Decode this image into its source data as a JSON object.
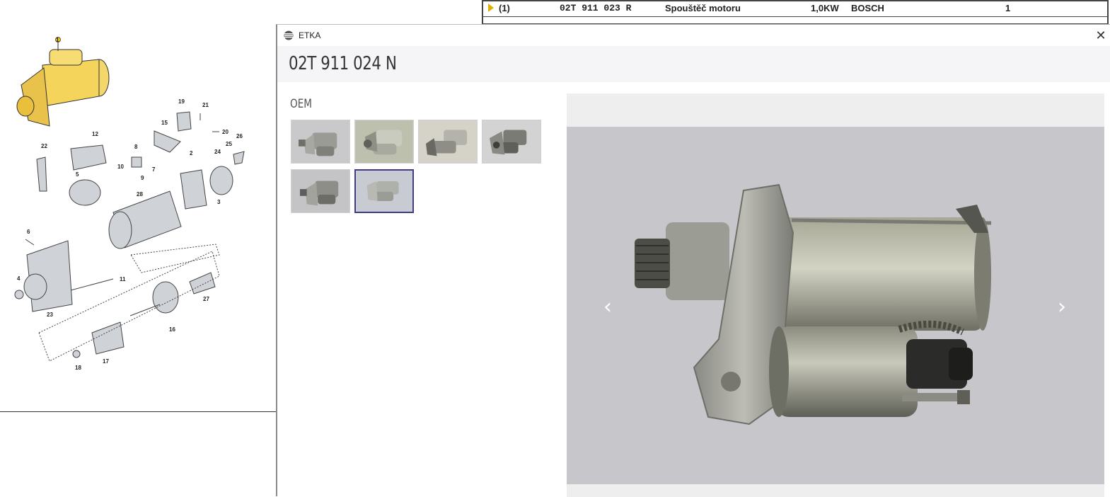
{
  "parts_table": {
    "row": {
      "position": "(1)",
      "part_number": "02T 911 023 R",
      "description": "Spouštěč motoru",
      "power": "1,0KW",
      "brand": "BOSCH",
      "quantity": "1"
    }
  },
  "diagram": {
    "callouts": [
      "1",
      "19",
      "21",
      "20",
      "15",
      "26",
      "12",
      "8",
      "25",
      "22",
      "24",
      "10",
      "9",
      "7",
      "2",
      "5",
      "28",
      "3",
      "6",
      "4",
      "11",
      "27",
      "23",
      "16",
      "17",
      "18"
    ]
  },
  "modal": {
    "app_title": "ETKA",
    "part_number": "02T 911 024 N",
    "section_label": "OEM",
    "thumbnail_count": 6,
    "selected_thumbnail": 6,
    "close_icon": "close-icon",
    "prev_icon": "chevron-left-icon",
    "next_icon": "chevron-right-icon"
  },
  "colors": {
    "accent_selected": "#3e3a8c",
    "highlight_part": "#f2c94c",
    "band": "#f5f5f7"
  }
}
